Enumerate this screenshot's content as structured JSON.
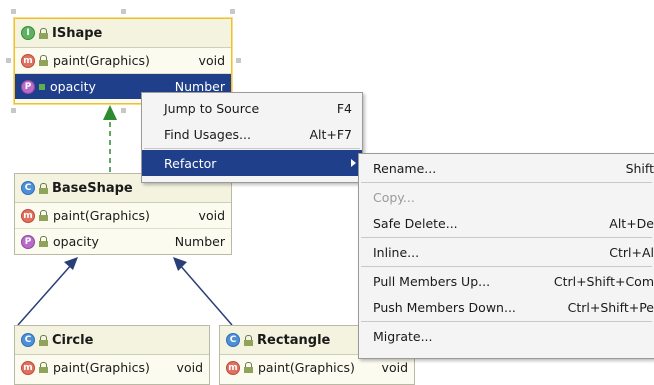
{
  "diagram": {
    "ishape": {
      "name": "IShape",
      "badge": "I",
      "rows": [
        {
          "badge": "m",
          "name": "paint(Graphics)",
          "type": "void"
        },
        {
          "badge": "P",
          "name": "opacity",
          "type": "Number"
        }
      ]
    },
    "baseshape": {
      "name": "BaseShape",
      "badge": "C",
      "rows": [
        {
          "badge": "m",
          "name": "paint(Graphics)",
          "type": "void"
        },
        {
          "badge": "P",
          "name": "opacity",
          "type": "Number"
        }
      ]
    },
    "circle": {
      "name": "Circle",
      "badge": "C",
      "rows": [
        {
          "badge": "m",
          "name": "paint(Graphics)",
          "type": "void"
        }
      ]
    },
    "rectangle": {
      "name": "Rectangle",
      "badge": "C",
      "rows": [
        {
          "badge": "m",
          "name": "paint(Graphics)",
          "type": "void"
        }
      ]
    }
  },
  "context_menu": {
    "items": [
      {
        "label": "Jump to Source",
        "shortcut": "F4"
      },
      {
        "label": "Find Usages...",
        "shortcut": "Alt+F7"
      },
      {
        "label": "Refactor",
        "shortcut": ""
      }
    ]
  },
  "refactor_menu": {
    "items": [
      {
        "label": "Rename...",
        "shortcut": "Shift"
      },
      {
        "label": "Copy...",
        "shortcut": ""
      },
      {
        "label": "Safe Delete...",
        "shortcut": "Alt+De"
      },
      {
        "label": "Inline...",
        "shortcut": "Ctrl+Al"
      },
      {
        "label": "Pull Members Up...",
        "shortcut": "Ctrl+Shift+Com"
      },
      {
        "label": "Push Members Down...",
        "shortcut": "Ctrl+Shift+Pe"
      },
      {
        "label": "Migrate...",
        "shortcut": ""
      }
    ]
  },
  "colors": {
    "selection": "#1f3f8a",
    "node_fill": "#fbfbef",
    "selected_border": "#f0c030",
    "edge": "#2a3f7a",
    "realization_edge": "#2e8a2e"
  }
}
